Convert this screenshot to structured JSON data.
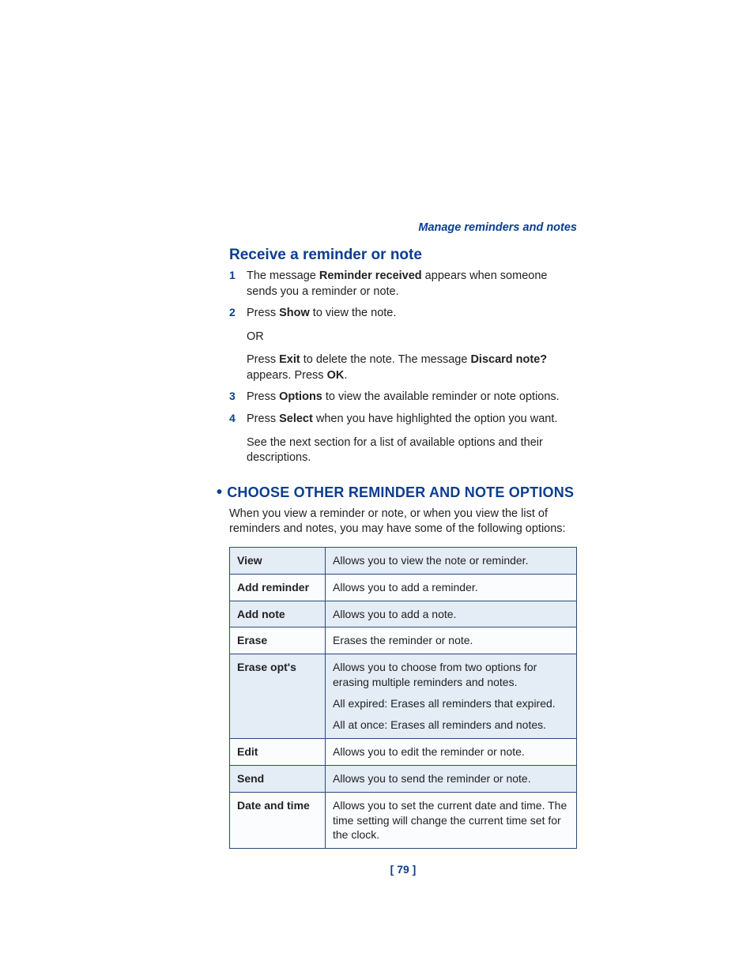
{
  "header": {
    "label": "Manage reminders and notes"
  },
  "section1": {
    "title": "Receive a reminder or note",
    "steps": [
      {
        "num": "1",
        "parts": [
          {
            "pre": "The message ",
            "bold": "Reminder received",
            "post": " appears when someone sends you a reminder or note."
          }
        ]
      },
      {
        "num": "2",
        "parts": [
          {
            "pre": "Press ",
            "bold": "Show",
            "post": " to view the note."
          },
          {
            "pre": "OR"
          },
          {
            "pre": "Press ",
            "bold": "Exit",
            "post": " to delete the note. The message ",
            "bold2": "Discard note?",
            "post2": " appears. Press ",
            "bold3": "OK",
            "post3": "."
          }
        ]
      },
      {
        "num": "3",
        "parts": [
          {
            "pre": "Press ",
            "bold": "Options",
            "post": " to view the available reminder or note options."
          }
        ]
      },
      {
        "num": "4",
        "parts": [
          {
            "pre": "Press ",
            "bold": "Select",
            "post": " when you have highlighted the option you want."
          },
          {
            "pre": "See the next section for a list of available options and their descriptions."
          }
        ]
      }
    ]
  },
  "section2": {
    "title": "CHOOSE OTHER REMINDER AND NOTE OPTIONS",
    "intro": "When you view a reminder or note, or when you view the list of reminders and notes, you may have some of the following options:",
    "rows": [
      {
        "name": "View",
        "desc": [
          "Allows you to view the note or reminder."
        ]
      },
      {
        "name": "Add reminder",
        "desc": [
          "Allows you to add a reminder."
        ]
      },
      {
        "name": "Add note",
        "desc": [
          "Allows you to add a note."
        ]
      },
      {
        "name": "Erase",
        "desc": [
          "Erases the reminder or note."
        ]
      },
      {
        "name": "Erase opt's",
        "desc": [
          "Allows you to choose from two options for erasing multiple reminders and notes.",
          "All expired: Erases all reminders that expired.",
          "All at once: Erases all reminders and notes."
        ]
      },
      {
        "name": "Edit",
        "desc": [
          "Allows you to edit the reminder or note."
        ]
      },
      {
        "name": "Send",
        "desc": [
          "Allows you to send the reminder or note."
        ]
      },
      {
        "name": "Date and time",
        "desc": [
          "Allows you to set the current date and time. The time setting will change the current time set for the clock."
        ]
      }
    ]
  },
  "footer": {
    "page": "[ 79 ]"
  }
}
